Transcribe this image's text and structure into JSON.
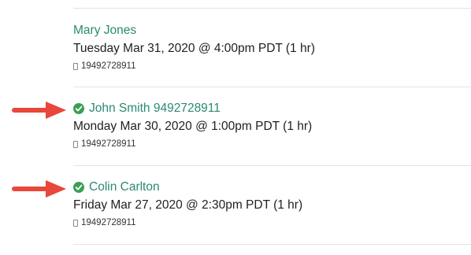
{
  "appointments": [
    {
      "name": "Mary Jones",
      "confirmed": false,
      "when": "Tuesday Mar 31, 2020 @ 4:00pm PDT (1 hr)",
      "phone": "19492728911"
    },
    {
      "name": "John Smith 9492728911",
      "confirmed": true,
      "when": "Monday Mar 30, 2020 @ 1:00pm PDT (1 hr)",
      "phone": "19492728911"
    },
    {
      "name": "Colin Carlton",
      "confirmed": true,
      "when": "Friday Mar 27, 2020 @ 2:30pm PDT (1 hr)",
      "phone": "19492728911"
    }
  ],
  "colors": {
    "name_link": "#2a8a72",
    "check": "#3aa055",
    "arrow": "#e8473a",
    "divider": "#e3e3e3"
  },
  "icons": {
    "confirmed": "check-circle-icon",
    "phone": "phone-icon",
    "annotation": "red-arrow-icon"
  }
}
